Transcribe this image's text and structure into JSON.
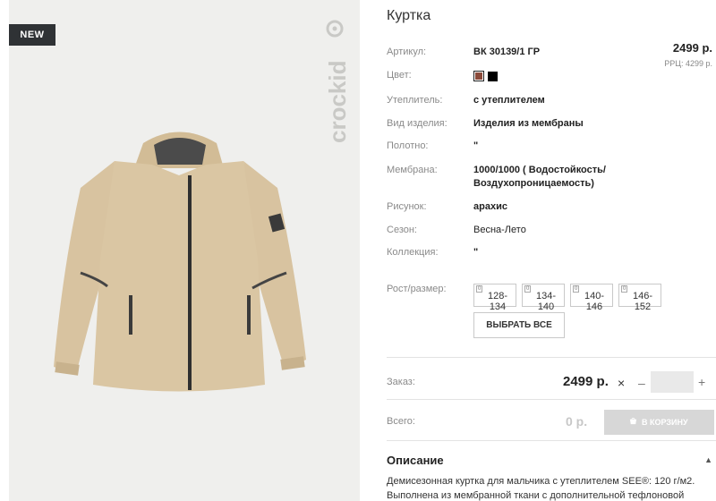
{
  "badge": "NEW",
  "brand": "crockid",
  "product": {
    "title": "Куртка",
    "price": "2499 р.",
    "rrp": "РРЦ: 4299 р."
  },
  "props": {
    "article_label": "Артикул:",
    "article_value": "ВК 30139/1 ГР",
    "color_label": "Цвет:",
    "colors": [
      "#8b4a3a",
      "#000000"
    ],
    "insulation_label": "Утеплитель:",
    "insulation_value": "с утеплителем",
    "type_label": "Вид изделия:",
    "type_value": "Изделия из мембраны",
    "fabric_label": "Полотно:",
    "fabric_value": "\"",
    "membrane_label": "Мембрана:",
    "membrane_value_1": "1000/1000 ( Водостойкость/",
    "membrane_value_2": "Воздухопроницаемость)",
    "pattern_label": "Рисунок:",
    "pattern_value": "арахис",
    "season_label": "Сезон:",
    "season_value": "Весна-Лето",
    "collection_label": "Коллекция:",
    "collection_value": "\"",
    "size_label": "Рост/размер:"
  },
  "sizes": [
    {
      "idx": "0",
      "label": "128-134"
    },
    {
      "idx": "0",
      "label": "134-140"
    },
    {
      "idx": "0",
      "label": "140-146"
    },
    {
      "idx": "0",
      "label": "146-152"
    }
  ],
  "select_all": "ВЫБРАТЬ ВСЕ",
  "order": {
    "label": "Заказ:",
    "price": "2499 р.",
    "x": "×",
    "minus": "–",
    "plus": "+",
    "qty": ""
  },
  "total": {
    "label": "Всего:",
    "value": "0 р.",
    "cart": "В КОРЗИНУ"
  },
  "description": {
    "title": "Описание",
    "toggle": "▲",
    "text": "Демисезонная куртка для мальчика с утеплителем SEE®: 120 г/м2. Выполнена из мембранной ткани с дополнительной тефлоновой"
  }
}
